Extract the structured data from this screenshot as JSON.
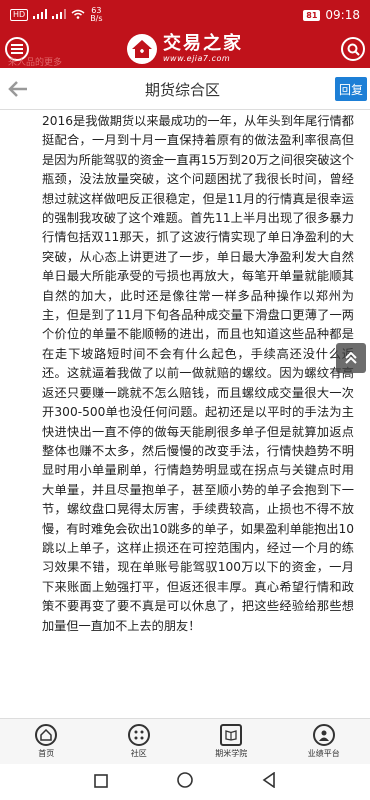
{
  "status": {
    "hd": "HD",
    "signal_1": "1",
    "net_speed": "63",
    "net_unit": "B/s",
    "battery": "81",
    "time": "09:18"
  },
  "app": {
    "name": "交易之家",
    "url": "www.ejia7.com",
    "faint_text": "来人品的更多"
  },
  "page": {
    "title": "期货综合区",
    "reply_label": "回复"
  },
  "post": {
    "body": "2016是我做期货以来最成功的一年，从年头到年尾行情都挺配合，一月到十月一直保持着原有的做法盈利率很高但是因为所能驾驭的资金一直再15万到20万之间很突破这个瓶颈，没法放量突破，这个问题困扰了我很长时间，曾经想过就这样做吧反正很稳定，但是11月的行情真是很幸运的强制我攻破了这个难题。首先11上半月出现了很多暴力行情包括双11那天，抓了这波行情实现了单日净盈利的大突破，从心态上讲更进了一步，单日最大净盈利发大自然单日最大所能承受的亏损也再放大，每笔开单量就能顺其自然的加大，此时还是像往常一样多品种操作以郑州为主，但是到了11月下旬各品种成交量下滑盘口更薄了一两个价位的单量不能顺畅的进出，而且也知道这些品种都是在走下坡路短时间不会有什么起色，手续高还没什么返还。这就逼着我做了以前一做就赔的螺纹。因为螺纹有高返还只要赚一跳就不怎么赔钱，而且螺纹成交量很大一次开300-500单也没任何问题。起初还是以平时的手法为主快进快出一直不停的做每天能刷很多单子但是就算加返点整体也赚不太多，然后慢慢的改变手法，行情快趋势不明显时用小单量刷单，行情趋势明显或在拐点与关键点时用大单量，并且尽量抱单子，甚至顺小势的单子会抱到下一节，螺纹盘口晃得太厉害，手续费较高，止损也不得不放慢，有时难免会砍出10跳多的单子，如果盈利单能抱出10跳以上单子，这样止损还在可控范围内，经过一个月的练习效果不错，现在单账号能驾驭100万以下的资金，一月下来账面上勉强打平，但返还很丰厚。真心希望行情和政策不要再变了要不真是可以休息了，把这些经验给那些想加量但一直加不上去的朋友！"
  },
  "tabs": [
    {
      "label": "首页",
      "icon": "home-icon"
    },
    {
      "label": "社区",
      "icon": "community-icon"
    },
    {
      "label": "期米学院",
      "icon": "book-icon"
    },
    {
      "label": "业绩平台",
      "icon": "user-icon"
    }
  ],
  "colors": {
    "brand": "#c0121b",
    "reply": "#1d7fd6"
  }
}
